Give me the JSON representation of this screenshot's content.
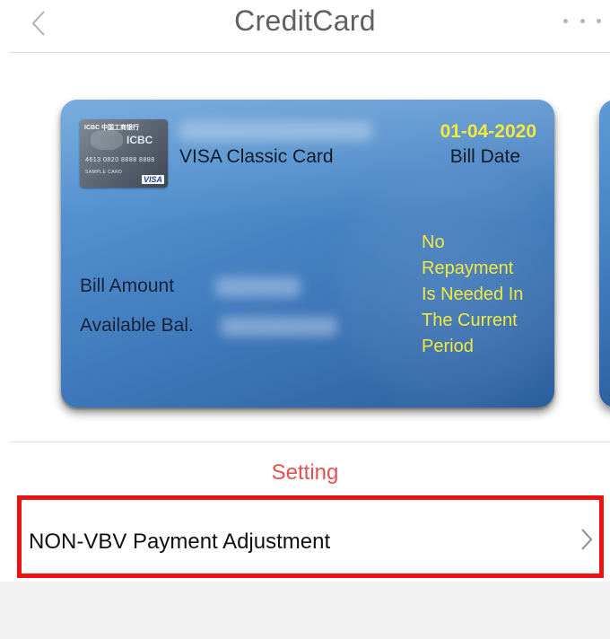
{
  "header": {
    "title": "CreditCard",
    "back_icon": "chevron-left-icon",
    "more_icon": "more-horizontal-icon"
  },
  "card": {
    "name": "VISA Classic Card",
    "bill_date_value": "01-04-2020",
    "bill_date_label": "Bill Date",
    "bill_amount_label": "Bill Amount",
    "available_balance_label": "Available Bal.",
    "repayment_lines": [
      "No",
      "Repayment",
      "Is Needed In",
      "The Current",
      "Period"
    ],
    "thumbnail": {
      "bank_text": "ICBC 中国工商银行",
      "brand_text": "ICBC",
      "number_text": "4613 0820 8888 8888",
      "sample_text": "SAMPLE CARD",
      "network": "VISA"
    },
    "highlight_color": "#f5ea3a"
  },
  "settings": {
    "tab_label": "Setting",
    "accent_color": "#e15353",
    "items": [
      {
        "label": "NON-VBV Payment Adjustment",
        "icon": "chevron-right-icon"
      }
    ]
  },
  "annotation_color": "#ee1212"
}
